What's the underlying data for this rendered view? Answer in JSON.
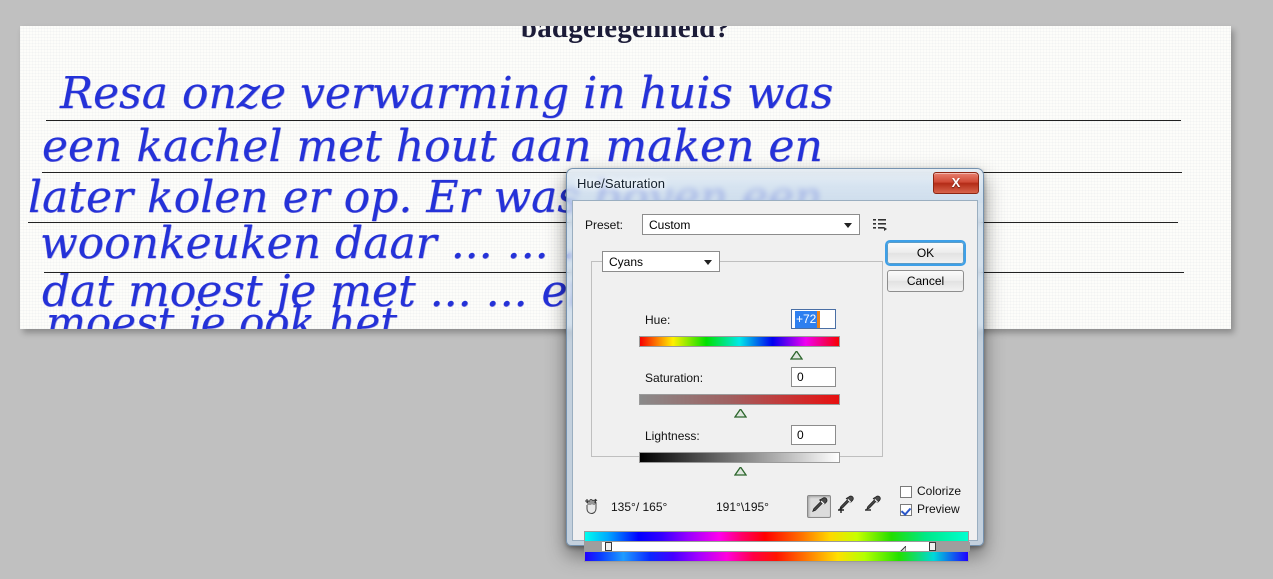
{
  "desktop": {
    "background_color": "#c0c0c0"
  },
  "document": {
    "name": "scanned-handwritten-letter",
    "top_cut_text": "badgelegenheid?",
    "ink_color": "#2432d8",
    "lines": [
      "Resa onze verwarming in huis was",
      "een kachel met hout aan maken en",
      "later kolen er op. Er was boven een",
      "woonkeuken daar ... ... ... ...nuis",
      "dat moest je met ... ... en daar",
      "moest je ook het ..."
    ]
  },
  "dialog": {
    "title": "Hue/Saturation",
    "close_label": "X",
    "preset": {
      "label": "Preset:",
      "value": "Custom",
      "options_icon": "preset-options-icon"
    },
    "buttons": {
      "ok": "OK",
      "cancel": "Cancel"
    },
    "range_channel": {
      "value": "Cyans"
    },
    "sliders": [
      {
        "label": "Hue:",
        "value": "+72",
        "selected": true,
        "thumb_percent": 78
      },
      {
        "label": "Saturation:",
        "value": "0",
        "selected": false,
        "thumb_percent": 50
      },
      {
        "label": "Lightness:",
        "value": "0",
        "selected": false,
        "thumb_percent": 50
      }
    ],
    "range_readout": {
      "scrub_icon": "scrubby-hand-icon",
      "inner_range": "135°/ 165°",
      "outer_range": "191°\\195°"
    },
    "eyedroppers": [
      {
        "name": "eyedropper-tool",
        "active": true
      },
      {
        "name": "eyedropper-add-tool",
        "active": false
      },
      {
        "name": "eyedropper-subtract-tool",
        "active": false
      }
    ],
    "checkboxes": [
      {
        "label": "Colorize",
        "checked": false
      },
      {
        "label": "Preview",
        "checked": true
      }
    ],
    "color_bars": {
      "left_grey_end_pct": 4,
      "left_handle_pct": 6,
      "right_tri_pct": 82,
      "right_handle_pct": 90,
      "right_grey_start_pct": 90
    }
  }
}
